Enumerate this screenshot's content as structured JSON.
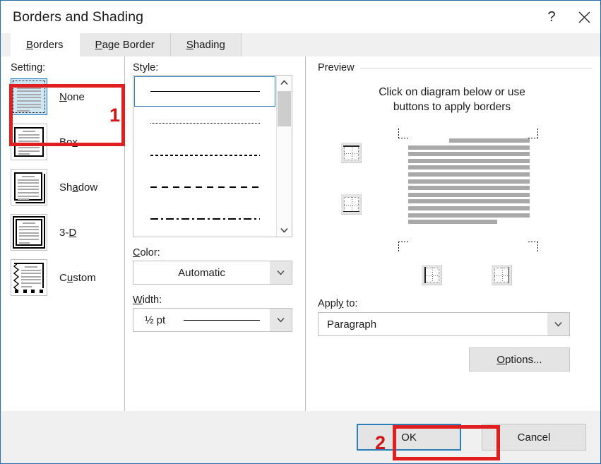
{
  "window": {
    "title": "Borders and Shading",
    "help_icon": "question-mark-icon",
    "close_icon": "close-icon"
  },
  "tabs": [
    {
      "label": "Borders",
      "accesskey": "B",
      "active": true
    },
    {
      "label": "Page Border",
      "accesskey": "P",
      "active": false
    },
    {
      "label": "Shading",
      "accesskey": "S",
      "active": false
    }
  ],
  "setting": {
    "group_label": "Setting:",
    "items": [
      {
        "label": "None",
        "accesskey": "N",
        "selected": true,
        "icon": "border-none-icon"
      },
      {
        "label": "Box",
        "accesskey": "x",
        "selected": false,
        "icon": "border-box-icon"
      },
      {
        "label": "Shadow",
        "accesskey": "a",
        "selected": false,
        "icon": "border-shadow-icon"
      },
      {
        "label": "3-D",
        "accesskey": "D",
        "selected": false,
        "icon": "border-3d-icon"
      },
      {
        "label": "Custom",
        "accesskey": "u",
        "selected": false,
        "icon": "border-custom-icon"
      }
    ]
  },
  "style": {
    "group_label": "Style:",
    "items": [
      {
        "name": "solid",
        "selected": true
      },
      {
        "name": "dotted",
        "selected": false
      },
      {
        "name": "fine-dashed",
        "selected": false
      },
      {
        "name": "dashed",
        "selected": false
      },
      {
        "name": "dash-dot",
        "selected": false
      }
    ],
    "scroll_up_icon": "chevron-up-icon",
    "scroll_down_icon": "chevron-down-icon"
  },
  "color": {
    "label": "Color:",
    "accesskey": "C",
    "value": "Automatic",
    "arrow_icon": "chevron-down-icon"
  },
  "width": {
    "label": "Width:",
    "accesskey": "W",
    "value": "½ pt",
    "arrow_icon": "chevron-down-icon"
  },
  "preview": {
    "group_label": "Preview",
    "hint_line1": "Click on diagram below or use",
    "hint_line2": "buttons to apply borders",
    "buttons": [
      {
        "name": "top-border-toggle"
      },
      {
        "name": "bottom-border-toggle"
      },
      {
        "name": "left-border-toggle"
      },
      {
        "name": "right-border-toggle"
      }
    ],
    "diagram_lines": 13
  },
  "apply_to": {
    "label": "Apply to:",
    "accesskey": "y",
    "value": "Paragraph",
    "arrow_icon": "chevron-down-icon"
  },
  "options_button": {
    "label": "Options...",
    "accesskey": "O"
  },
  "footer": {
    "ok_label": "OK",
    "cancel_label": "Cancel"
  },
  "annotations": [
    {
      "number": "1",
      "target": "setting-none"
    },
    {
      "number": "2",
      "target": "ok-button"
    }
  ],
  "colors": {
    "annotation_red": "#e02020",
    "focus_blue": "#2b7fb8",
    "selection_blue": "#cfe6f5",
    "dialog_border": "#2a6ca8"
  }
}
